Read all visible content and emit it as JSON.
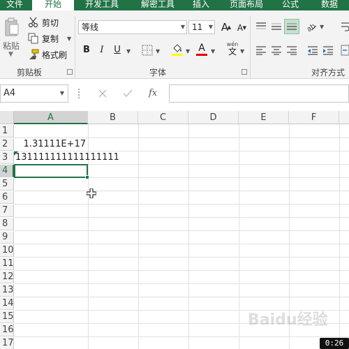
{
  "tabs": [
    {
      "label": "文件",
      "active": false
    },
    {
      "label": "开始",
      "active": true
    },
    {
      "label": "开发工具",
      "active": false
    },
    {
      "label": "解密工具",
      "active": false
    },
    {
      "label": "插入",
      "active": false
    },
    {
      "label": "页面布局",
      "active": false
    },
    {
      "label": "公式",
      "active": false
    },
    {
      "label": "数据",
      "active": false
    }
  ],
  "clipboard": {
    "paste_label": "粘贴",
    "cut_label": "剪切",
    "copy_label": "复制",
    "format_painter_label": "格式刷",
    "group_label": "剪贴板"
  },
  "font": {
    "name": "等线",
    "size": "11",
    "group_label": "字体",
    "bold": "B",
    "italic": "I",
    "underline": "U",
    "grow": "A",
    "shrink": "A",
    "fill_letter": "",
    "color_letter": "A",
    "phonetic_top": "wén",
    "phonetic_bottom": "文"
  },
  "alignment": {
    "group_label": "对齐方式"
  },
  "namebox": {
    "value": "A4"
  },
  "formula": {
    "fx": "fx",
    "value": ""
  },
  "columns": [
    "A",
    "B",
    "C",
    "D",
    "E",
    "F"
  ],
  "rows": [
    "1",
    "2",
    "3",
    "4",
    "5",
    "6",
    "7",
    "8",
    "9",
    "10",
    "11",
    "12",
    "13",
    "14",
    "15",
    "16",
    "17"
  ],
  "cells": {
    "A2": "1.31111E+17",
    "A3": "131111111111111111"
  },
  "selected_cell": "A4",
  "accent": "#217346",
  "timer": "0:26",
  "watermark": "Baidu经验"
}
